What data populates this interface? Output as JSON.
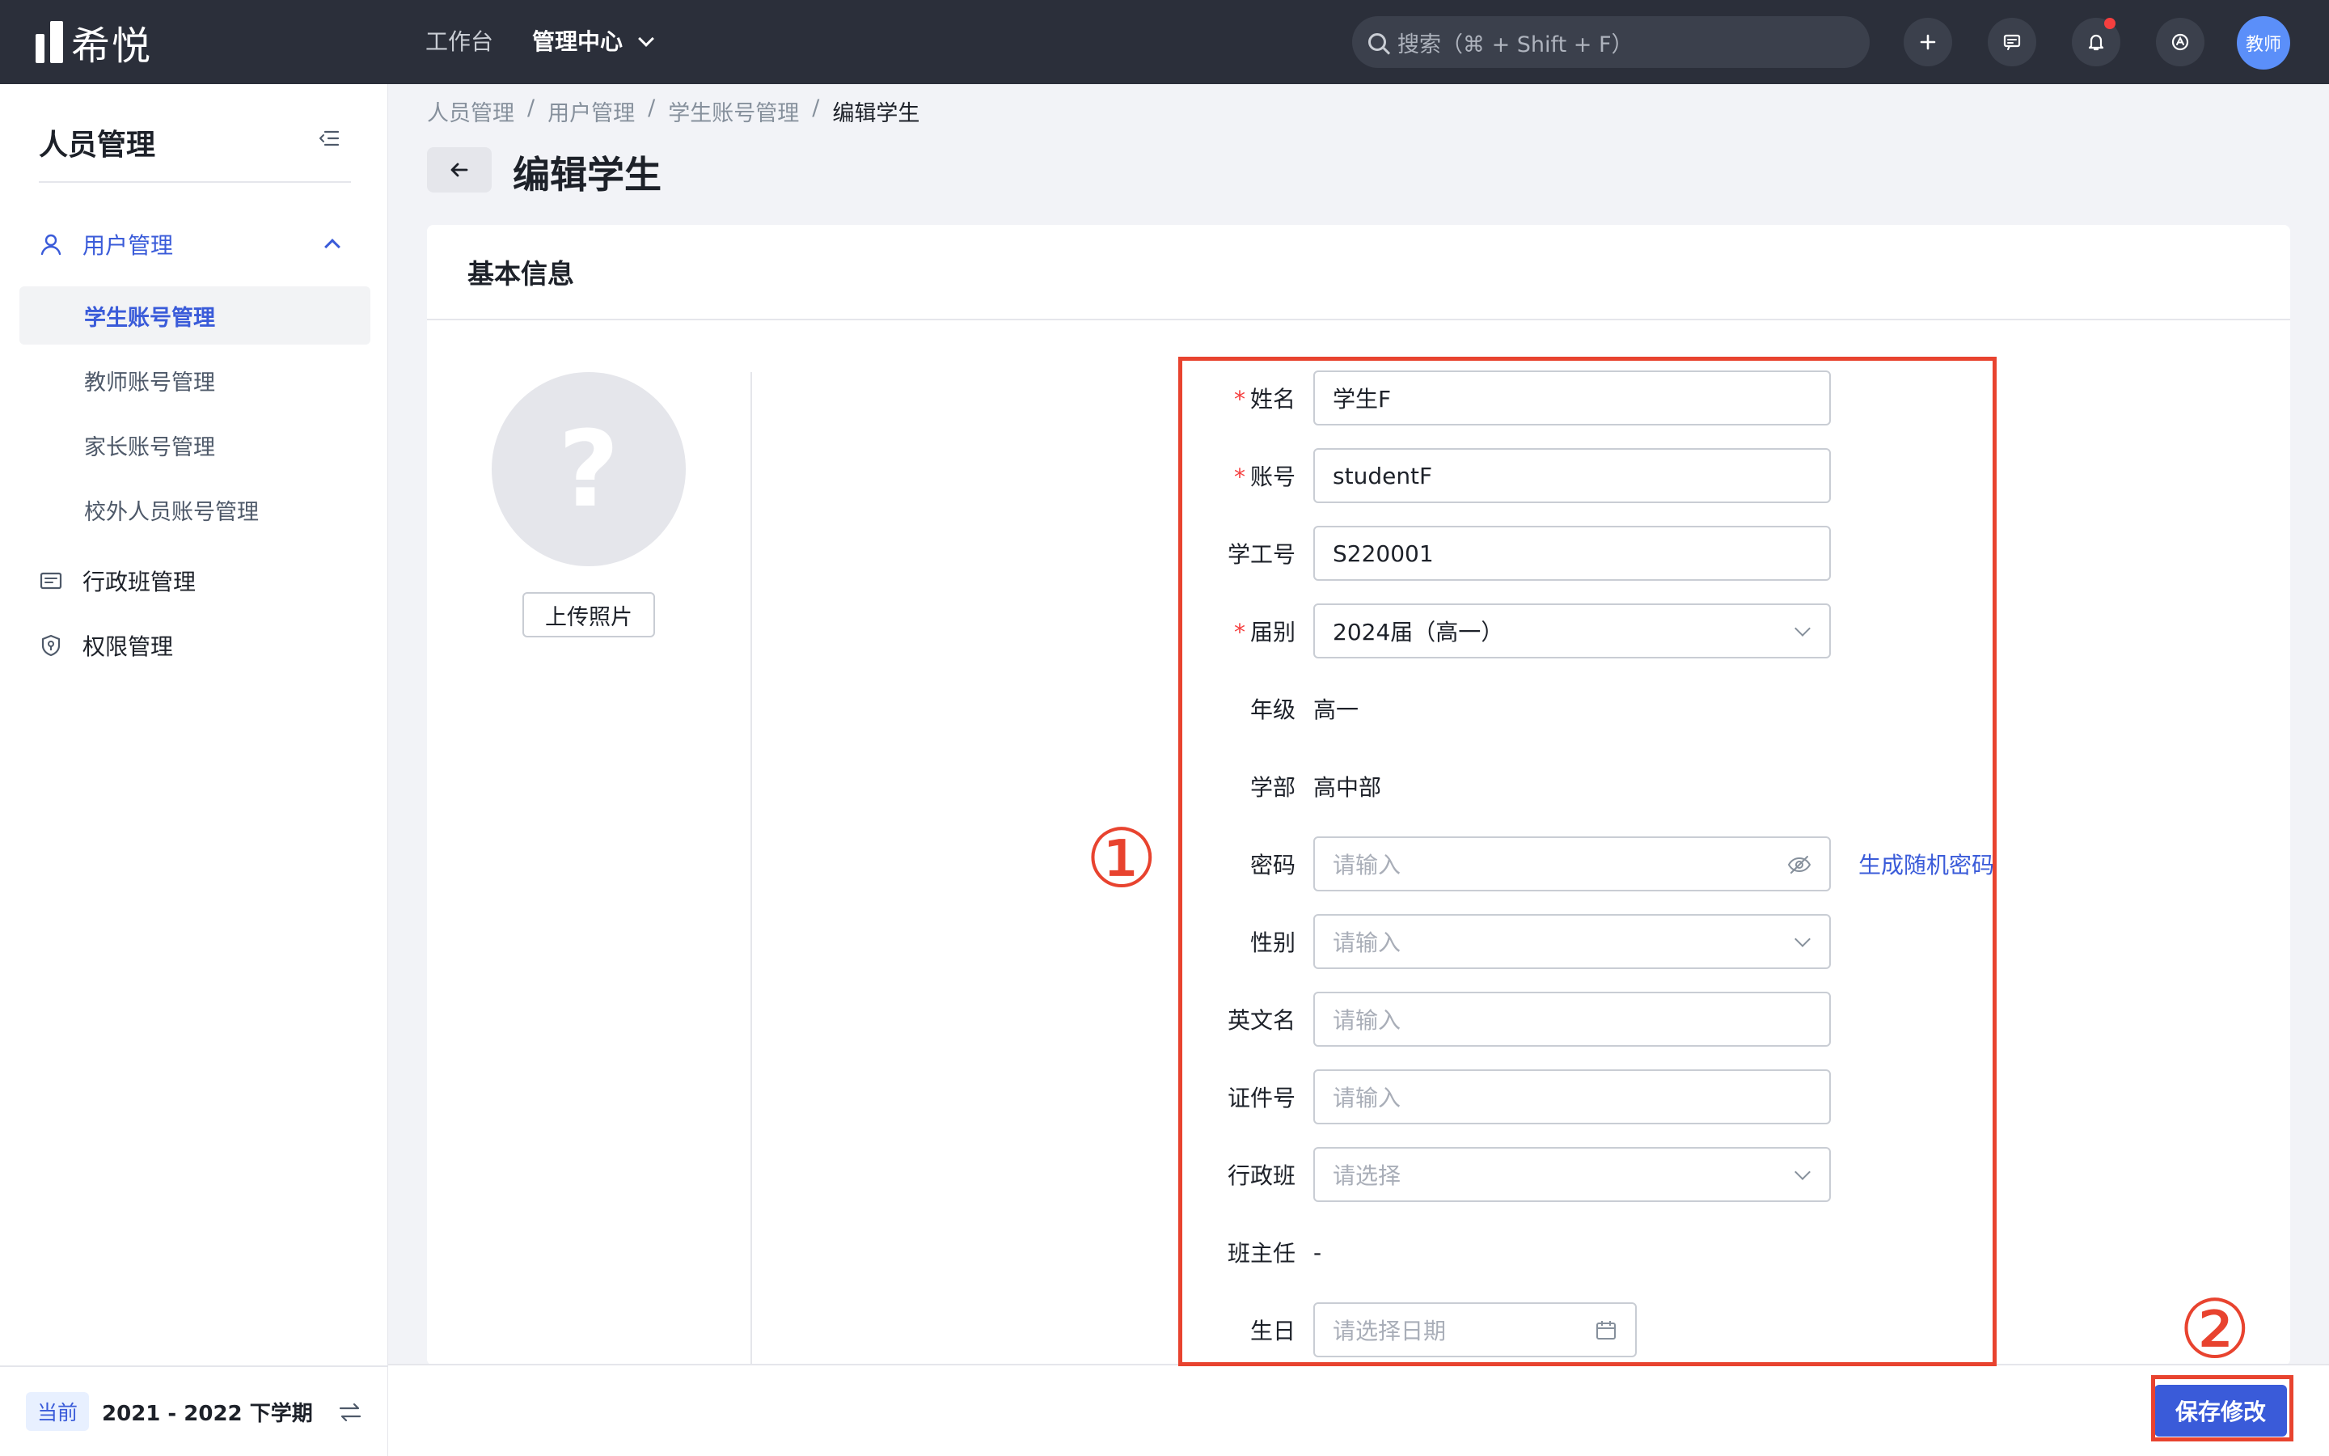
{
  "topbar": {
    "logo_text": "希悦",
    "nav": [
      {
        "label": "工作台"
      },
      {
        "label": "管理中心"
      }
    ],
    "search_placeholder": "搜索（⌘ + Shift + F）",
    "buttons": [
      {
        "icon": "plus-icon"
      },
      {
        "icon": "message-icon"
      },
      {
        "icon": "bell-icon"
      },
      {
        "icon": "app-icon"
      }
    ],
    "avatar_label": "教师"
  },
  "sidebar": {
    "title": "人员管理",
    "groups": [
      {
        "label": "用户管理",
        "icon": "user-icon",
        "expanded": true
      },
      {
        "label": "行政班管理",
        "icon": "class-icon"
      },
      {
        "label": "权限管理",
        "icon": "shield-icon"
      }
    ],
    "sub_items": [
      {
        "label": "学生账号管理",
        "active": true
      },
      {
        "label": "教师账号管理"
      },
      {
        "label": "家长账号管理"
      },
      {
        "label": "校外人员账号管理"
      }
    ],
    "footer": {
      "badge": "当前",
      "term": "2021 - 2022 下学期"
    }
  },
  "breadcrumb": [
    "人员管理",
    "/",
    "用户管理",
    "/",
    "学生账号管理",
    "/",
    "编辑学生"
  ],
  "page_title": "编辑学生",
  "card": {
    "title": "基本信息",
    "photo_placeholder": "?",
    "upload_label": "上传照片"
  },
  "form": {
    "name": {
      "label": "姓名",
      "value": "学生F"
    },
    "account": {
      "label": "账号",
      "value": "studentF"
    },
    "student_no": {
      "label": "学工号",
      "value": "S220001"
    },
    "cohort": {
      "label": "届别",
      "value": "2024届（高一）"
    },
    "grade": {
      "label": "年级",
      "value": "高一"
    },
    "division": {
      "label": "学部",
      "value": "高中部"
    },
    "password": {
      "label": "密码",
      "placeholder": "请输入",
      "link": "生成随机密码"
    },
    "gender": {
      "label": "性别",
      "placeholder": "请输入"
    },
    "english_name": {
      "label": "英文名",
      "placeholder": "请输入"
    },
    "id_no": {
      "label": "证件号",
      "placeholder": "请输入"
    },
    "admin_class": {
      "label": "行政班",
      "placeholder": "请选择"
    },
    "head_teacher": {
      "label": "班主任",
      "value": "-"
    },
    "birthday": {
      "label": "生日",
      "placeholder": "请选择日期"
    },
    "required_mark": "*"
  },
  "annotations": {
    "one": "①",
    "two": "②",
    "color": "#e8432f"
  },
  "save_label": "保存修改",
  "colors": {
    "topbar": "#2b2f3a",
    "accent": "#3a5bd9",
    "danger": "#f53f3f"
  }
}
